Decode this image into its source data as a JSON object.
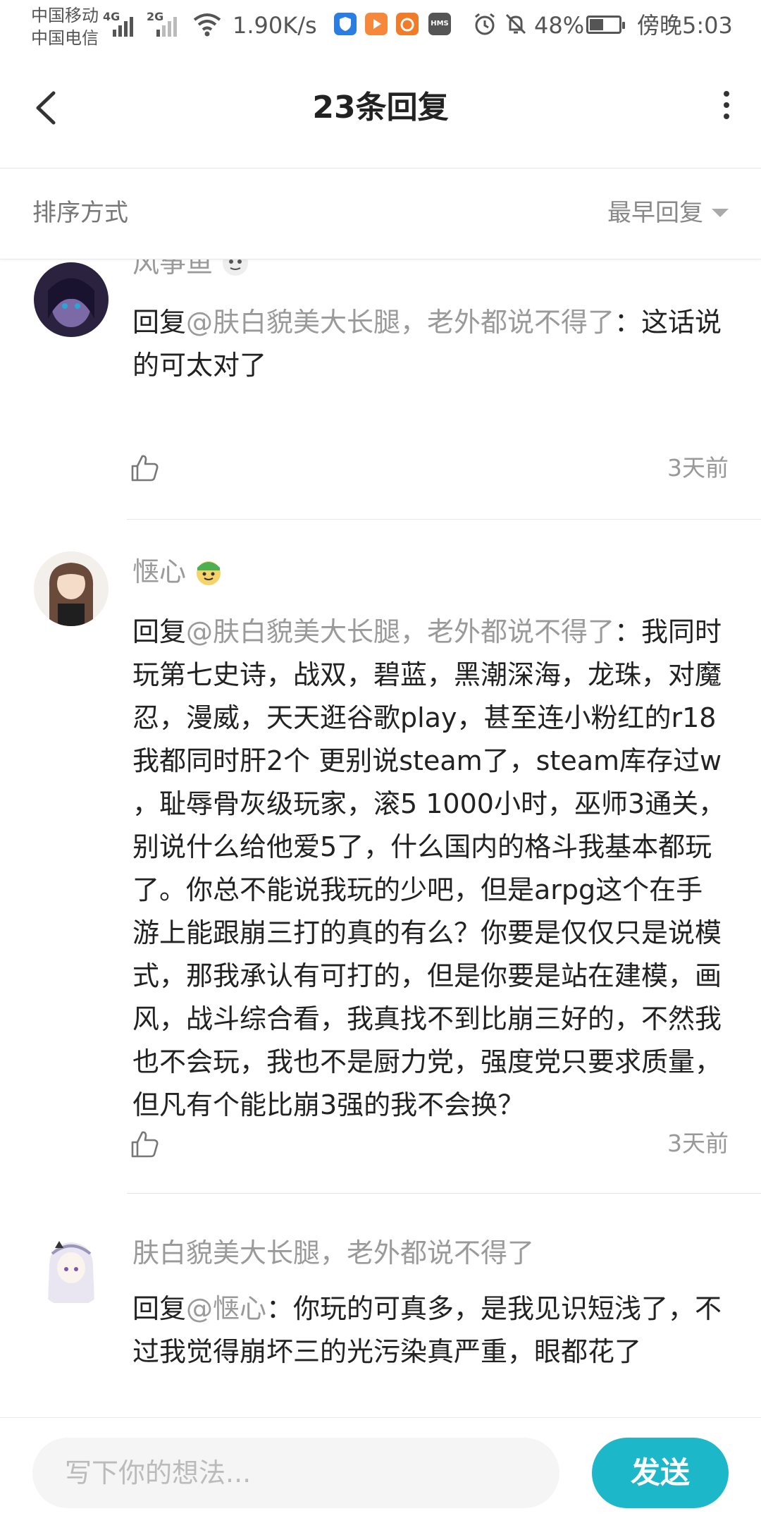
{
  "status_bar": {
    "carrier_1": "中国移动",
    "carrier_2": "中国电信",
    "sim1_network": "4G",
    "sim2_network": "2G",
    "net_speed": "1.90K/s",
    "battery_percent": "48%",
    "battery_level": 0.48,
    "time": "傍晚5:03",
    "app_icons": [
      {
        "name": "shield-app-icon",
        "color": "#2a7de1"
      },
      {
        "name": "video-app-icon",
        "color": "#f5883a"
      },
      {
        "name": "uc-browser-icon",
        "color": "#f07b28"
      },
      {
        "name": "hms-icon",
        "color": "#555555",
        "text": "HMS"
      }
    ]
  },
  "header": {
    "title": "23条回复",
    "back_icon": "chevron-left-icon",
    "more_icon": "more-vertical-icon"
  },
  "sort_bar": {
    "label": "排序方式",
    "selected": "最早回复"
  },
  "comments": [
    {
      "user": "风筝鱼",
      "avatar_colors": [
        "#2b2240",
        "#7b6aa6"
      ],
      "reply_prefix": "回复",
      "mention": "@肤白貌美大长腿，老外都说不得了",
      "text": "：这话说的可太对了",
      "time": "3天前"
    },
    {
      "user": "惬心",
      "avatar_colors": [
        "#6a4a3a",
        "#c9a27e"
      ],
      "reply_prefix": "回复",
      "mention": "@肤白貌美大长腿，老外都说不得了",
      "text": "：我同时玩第七史诗，战双，碧蓝，黑潮深海，龙珠，对魔忍，漫威，天天逛谷歌play，甚至连小粉红的r18我都同时肝2个 更别说steam了，steam库存过w ，耻辱骨灰级玩家，滚5 1000小时，巫师3通关，别说什么给他爱5了，什么国内的格斗我基本都玩了。你总不能说我玩的少吧，但是arpg这个在手游上能跟崩三打的真的有么？你要是仅仅只是说模式，那我承认有可打的，但是你要是站在建模，画风，战斗综合看，我真找不到比崩三好的，不然我也不会玩，我也不是厨力党，强度党只要求质量，但凡有个能比崩3强的我不会换？",
      "time": "3天前"
    },
    {
      "user": "肤白貌美大长腿，老外都说不得了",
      "avatar_colors": [
        "#e9e6f2",
        "#9a96b8"
      ],
      "reply_prefix": "回复",
      "mention": "@惬心",
      "text": "：你玩的可真多，是我见识短浅了，不过我觉得崩坏三的光污染真严重，眼都花了"
    }
  ],
  "input_bar": {
    "placeholder": "写下你的想法...",
    "send_label": "发送"
  },
  "colors": {
    "accent": "#1cb7c8",
    "name_gray": "#9a9a9a",
    "text": "#222222"
  }
}
